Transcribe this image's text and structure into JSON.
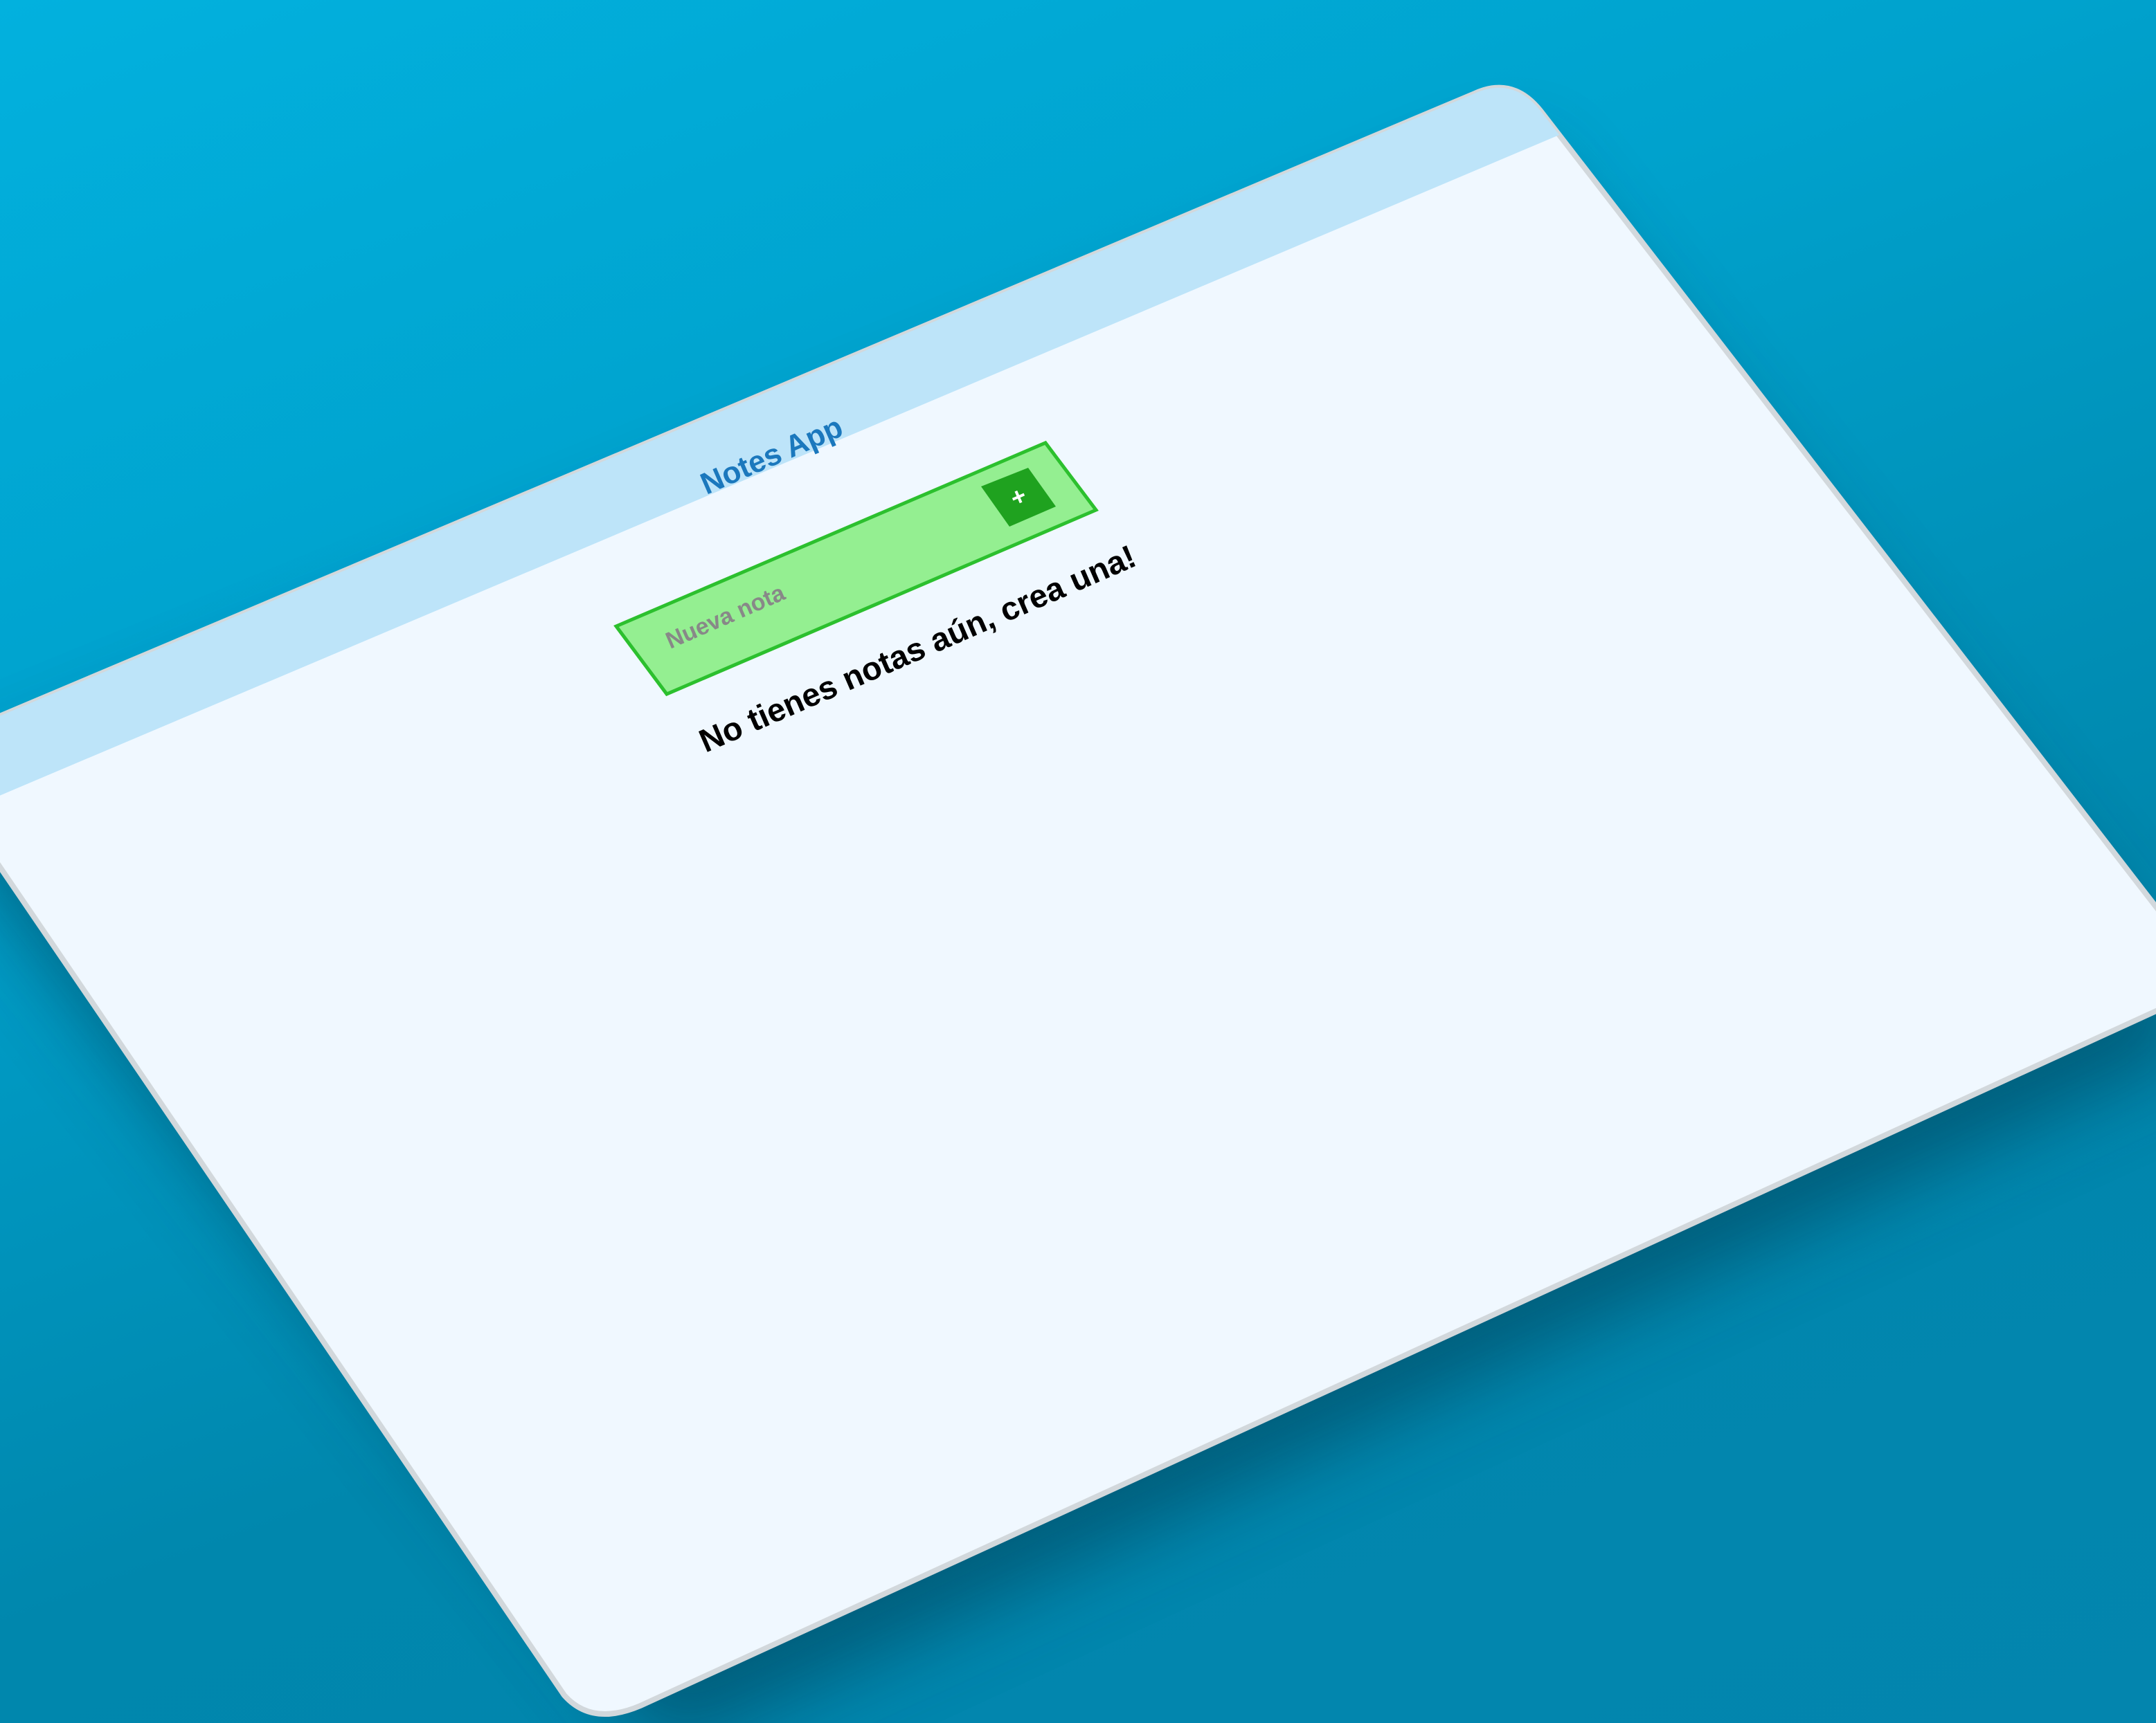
{
  "app": {
    "title": "Notes App"
  },
  "new_note": {
    "placeholder": "Nueva nota",
    "add_button_label": "+"
  },
  "notes": [],
  "empty_state": {
    "message": "No tienes notas aún, crea una!"
  },
  "colors": {
    "background": "#00a2cd",
    "window": "#f0f8ff",
    "header": "#bde4f9",
    "title": "#1b78bd",
    "input_fill": "#94ef91",
    "input_border": "#2cc02e",
    "add_button": "#1fa21f"
  }
}
